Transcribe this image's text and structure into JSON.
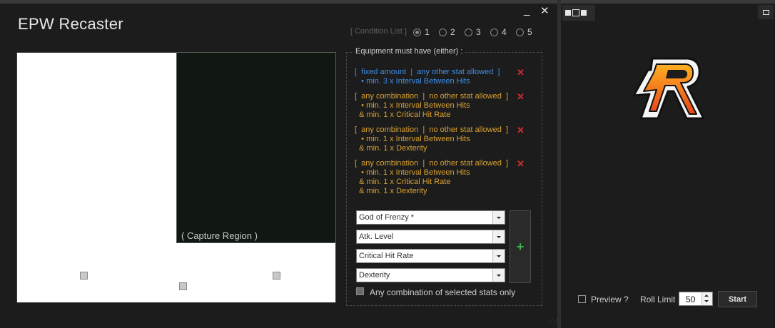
{
  "main_window": {
    "title": "EPW Recaster",
    "minimize_glyph": "_",
    "close_glyph": "✕"
  },
  "condition_list": {
    "label": "[ Condition List ]",
    "options": [
      "1",
      "2",
      "3",
      "4",
      "5"
    ],
    "selected": "1"
  },
  "capture": {
    "label": "( Capture Region )"
  },
  "equipment": {
    "title": "Equipment must have (either) :",
    "conditions": [
      {
        "lines": [
          "[  fixed amount  |  any other stat allowed  ]",
          "   • min. 3 x Interval Between Hits"
        ],
        "color": "#3f8de6"
      },
      {
        "lines": [
          "[  any combination  |  no other stat allowed  ]",
          "   • min. 1 x Interval Between Hits",
          "  & min. 1 x Critical Hit Rate"
        ],
        "color": "#d9a030"
      },
      {
        "lines": [
          "[  any combination  |  no other stat allowed  ]",
          "   • min. 1 x Interval Between Hits",
          "  & min. 1 x Dexterity"
        ],
        "color": "#d9a030"
      },
      {
        "lines": [
          "[  any combination  |  no other stat allowed  ]",
          "   • min. 1 x Interval Between Hits",
          "  & min. 1 x Critical Hit Rate",
          "  & min. 1 x Dexterity"
        ],
        "color": "#d9a030"
      }
    ],
    "remove_glyph": "✕"
  },
  "stat_selects": [
    "God of Frenzy *",
    "Atk. Level",
    "Critical Hit Rate",
    "Dexterity"
  ],
  "add_button_label": "+",
  "any_combination_label": "Any combination of selected stats only",
  "side_window": {
    "preview_label": "Preview ?",
    "roll_limit_label": "Roll Limit",
    "roll_limit_value": "50",
    "start_label": "Start"
  },
  "colors": {
    "blue": "#3f8de6",
    "orange": "#d9a030",
    "remove_red": "#d03030",
    "add_green": "#3cb44b"
  }
}
